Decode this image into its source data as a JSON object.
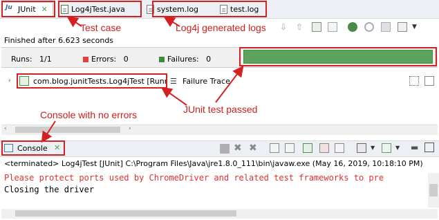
{
  "tabs": {
    "junit": "JUnit",
    "test_file": "Log4jTest.java",
    "system_log": "system.log",
    "test_log": "test.log"
  },
  "annotations": {
    "test_case": "Test case",
    "log4j_generated": "Log4j generated logs",
    "junit_passed": "JUnit test passed",
    "console_no_errors": "Console with no errors"
  },
  "junit_view": {
    "finished": "Finished after 6.623 seconds",
    "runs_label": "Runs:",
    "runs_value": "1/1",
    "errors_label": "Errors:",
    "errors_value": "0",
    "failures_label": "Failures:",
    "failures_value": "0",
    "progress_fraction": 1.0,
    "progress_color": "#5da35d",
    "test_item": "com.blog.junitTests.Log4jTest [Runr",
    "failure_trace": "Failure Trace"
  },
  "console": {
    "tab_label": "Console",
    "terminated": "<terminated> Log4jTest [JUnit] C:\\Program Files\\Java\\jre1.8.0_111\\bin\\javaw.exe (May 16, 2019, 10:18:10 PM)",
    "lines": [
      {
        "text": "Please protect ports used by ChromeDriver and related test frameworks to pre",
        "color": "#e03030"
      },
      {
        "text": "Closing the driver",
        "color": "#000000"
      }
    ]
  },
  "colors": {
    "annotation_red": "#d42020",
    "pass_green": "#5da35d"
  }
}
